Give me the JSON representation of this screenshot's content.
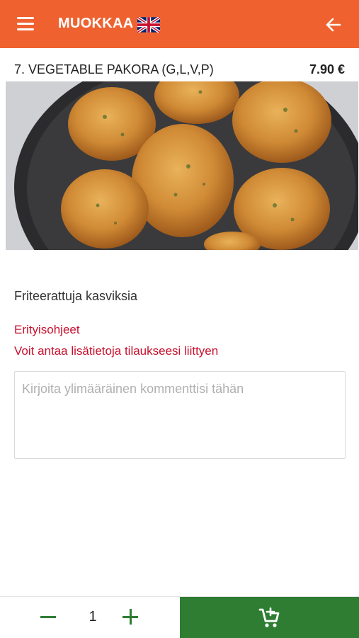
{
  "header": {
    "title": "MUOKKAA",
    "accent_color": "#ef6230",
    "menu_icon": "hamburger-menu-icon",
    "language_icon": "uk-flag-icon",
    "back_icon": "arrow-left-icon"
  },
  "product": {
    "name": "7. VEGETABLE PAKORA (G,L,V,P)",
    "price": "7.90 €",
    "description": "Friteerattuja kasviksia"
  },
  "instructions": {
    "title": "Erityisohjeet",
    "subtitle": "Voit antaa lisätietoja tilaukseesi liittyen",
    "comment_placeholder": "Kirjoita ylimääräinen kommenttisi tähän",
    "comment_value": "",
    "text_color": "#c8102e"
  },
  "order": {
    "quantity": "1",
    "button_color": "#2e7d32",
    "cart_icon": "add-to-cart-icon"
  }
}
